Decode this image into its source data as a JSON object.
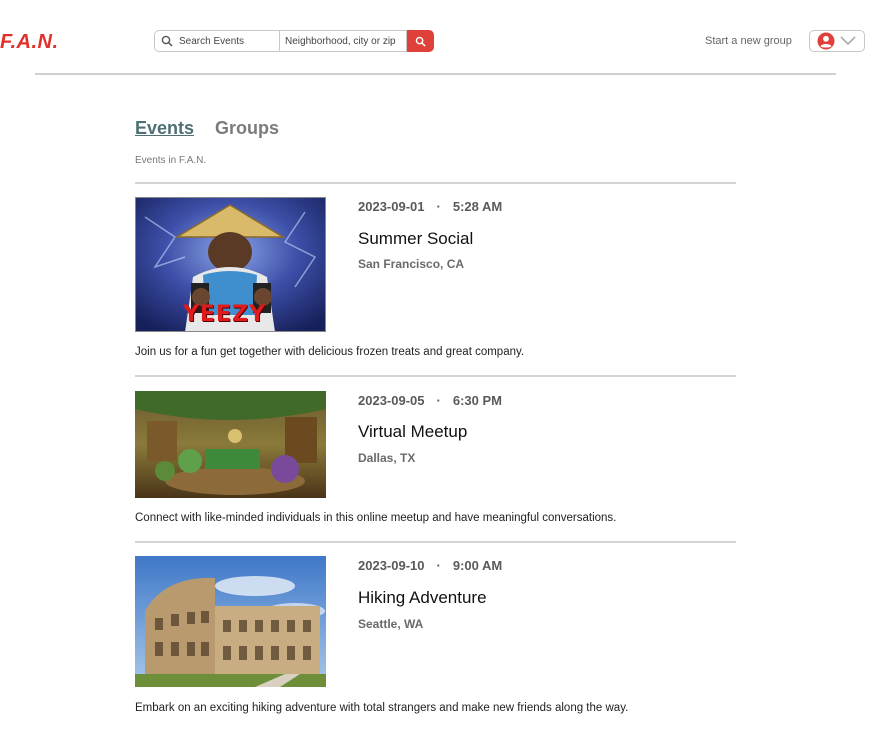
{
  "header": {
    "logo": "F.A.N.",
    "search_placeholder": "Search Events",
    "location_placeholder": "Neighborhood, city or zip",
    "start_group": "Start a new group",
    "accent": "#e0403a"
  },
  "tabs": {
    "events": "Events",
    "groups": "Groups"
  },
  "subtitle": "Events in F.A.N.",
  "events": [
    {
      "date": "2023-09-01",
      "time": "5:28 AM",
      "title": "Summer Social",
      "location": "San Francisco, CA",
      "image_text": "YEEZY",
      "description": "Join us for a fun get together with delicious frozen treats and great company."
    },
    {
      "date": "2023-09-05",
      "time": "6:30 PM",
      "title": "Virtual Meetup",
      "location": "Dallas, TX",
      "description": "Connect with like-minded individuals in this online meetup and have meaningful conversations."
    },
    {
      "date": "2023-09-10",
      "time": "9:00 AM",
      "title": "Hiking Adventure",
      "location": "Seattle, WA",
      "description": "Embark on an exciting hiking adventure with total strangers and make new friends along the way."
    }
  ]
}
